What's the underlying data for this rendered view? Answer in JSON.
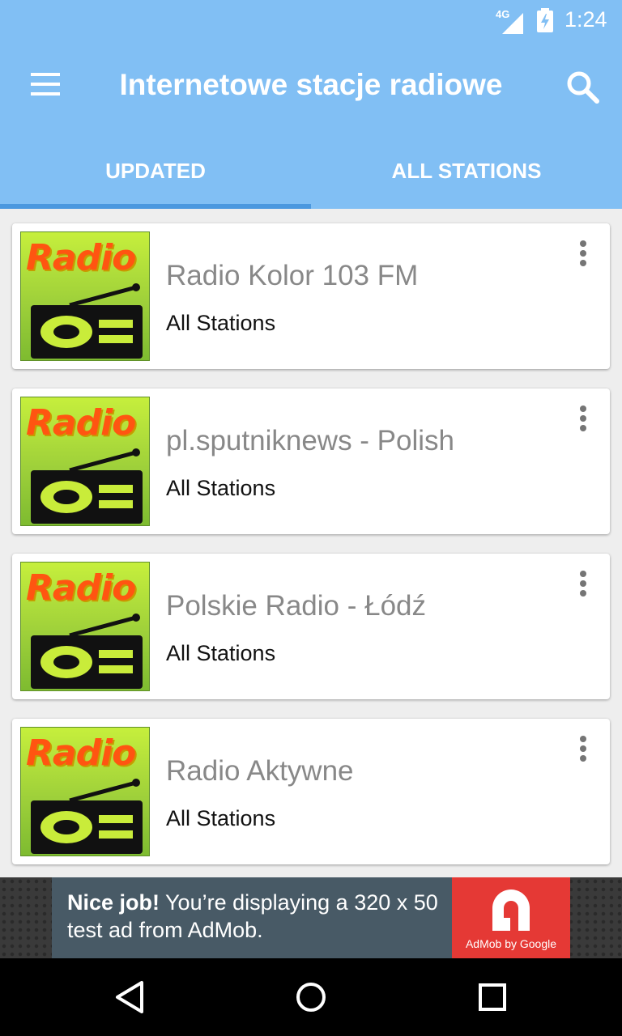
{
  "status_bar": {
    "network": "4G",
    "time": "1:24"
  },
  "app_bar": {
    "title": "Internetowe stacje radiowe"
  },
  "tabs": [
    {
      "label": "UPDATED",
      "selected": true
    },
    {
      "label": "ALL STATIONS",
      "selected": false
    }
  ],
  "stations": [
    {
      "thumb_text": "Radio",
      "title": "Radio Kolor 103 FM",
      "category": "All Stations"
    },
    {
      "thumb_text": "Radio",
      "title": "pl.sputniknews - Polish",
      "category": "All Stations"
    },
    {
      "thumb_text": "Radio",
      "title": "Polskie Radio - Łódź",
      "category": "All Stations"
    },
    {
      "thumb_text": "Radio",
      "title": "Radio Aktywne",
      "category": "All Stations"
    }
  ],
  "ad": {
    "headline": "Nice job!",
    "body": " You’re displaying a 320 x 50 test ad from AdMob.",
    "logo_caption": "AdMob by Google"
  },
  "colors": {
    "primary": "#81bff4",
    "tab_indicator": "#4b98df",
    "ad_red": "#e53935"
  }
}
